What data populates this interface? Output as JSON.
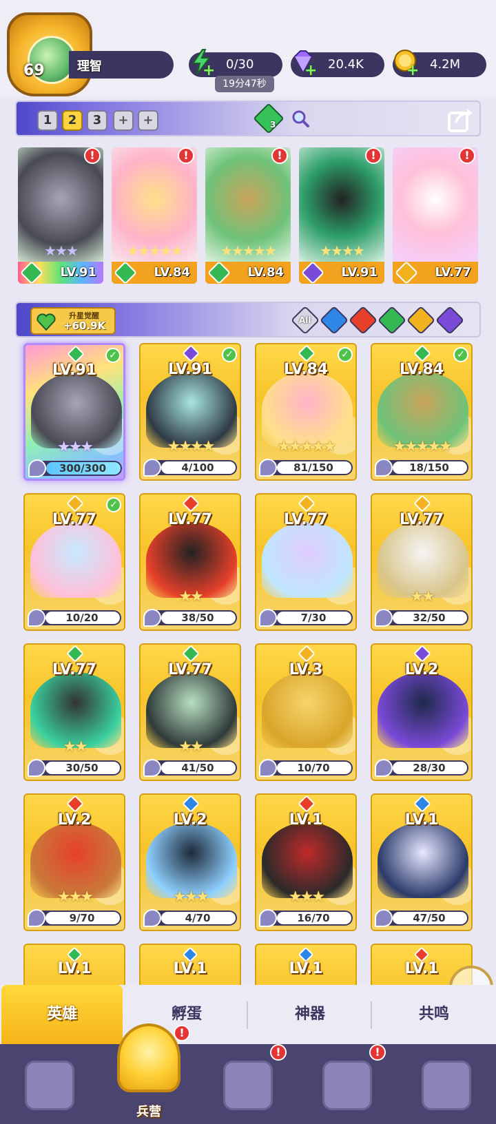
{
  "player": {
    "level": "69",
    "name": "理智"
  },
  "resources": {
    "energy": {
      "value": "0/30",
      "timer": "19分47秒",
      "icon": "lightning-icon",
      "color": "#49d36a"
    },
    "gems": {
      "value": "20.4K",
      "icon": "diamond-icon",
      "color": "#9b6bff"
    },
    "gold": {
      "value": "4.2M",
      "icon": "coin-icon",
      "color": "#f5c227"
    }
  },
  "team_tabs": {
    "slots": [
      "1",
      "2",
      "3",
      "+",
      "+"
    ],
    "active_slot": "2",
    "team_gem_count": "3"
  },
  "team": [
    {
      "level": "LV.91",
      "element": "nature",
      "stars": "★★★",
      "star_style": "purple",
      "bar": "rainbow",
      "alert": "!"
    },
    {
      "level": "LV.84",
      "element": "nature",
      "stars": "★★★★★",
      "star_style": "gold",
      "bar": "gold",
      "alert": "!"
    },
    {
      "level": "LV.84",
      "element": "nature",
      "stars": "★★★★★",
      "star_style": "gold",
      "bar": "gold",
      "alert": "!"
    },
    {
      "level": "LV.91",
      "element": "dark",
      "stars": "★★★★",
      "star_style": "gold",
      "bar": "gold",
      "alert": "!"
    },
    {
      "level": "LV.77",
      "element": "light",
      "stars": "",
      "star_style": "gold",
      "bar": "gold",
      "alert": "!"
    }
  ],
  "filter": {
    "awaken_title": "升星觉醒",
    "awaken_value": "+60.9K",
    "all_label": "All",
    "elements": [
      "water",
      "fire",
      "nature",
      "light",
      "dark"
    ]
  },
  "element_colors": {
    "nature": "#34b852",
    "dark": "#7a4ad8",
    "light": "#f2b21f",
    "fire": "#e6402a",
    "water": "#2e86e6"
  },
  "heroes": [
    {
      "level": "LV.91",
      "element": "nature",
      "stars": "★★★",
      "star_style": "purple",
      "progress": "300/300",
      "fill": 1.0,
      "checked": true,
      "rainbow": true,
      "portrait": [
        "#4a4a55",
        "#a5a5b5"
      ]
    },
    {
      "level": "LV.91",
      "element": "dark",
      "stars": "★★★★",
      "star_style": "gold",
      "progress": "4/100",
      "fill": 0.04,
      "checked": true,
      "rainbow": false,
      "portrait": [
        "#2e3a45",
        "#a8e6e0"
      ]
    },
    {
      "level": "LV.84",
      "element": "nature",
      "stars": "★★★★★",
      "star_style": "gold",
      "progress": "81/150",
      "fill": 0.54,
      "checked": true,
      "rainbow": false,
      "portrait": [
        "#ffe08a",
        "#ffb3c8"
      ]
    },
    {
      "level": "LV.84",
      "element": "nature",
      "stars": "★★★★★",
      "star_style": "gold",
      "progress": "18/150",
      "fill": 0.12,
      "checked": true,
      "rainbow": false,
      "portrait": [
        "#6fc27a",
        "#c9a45a"
      ]
    },
    {
      "level": "LV.77",
      "element": "light",
      "stars": "",
      "star_style": "gold",
      "progress": "10/20",
      "fill": 0.5,
      "checked": true,
      "rainbow": false,
      "portrait": [
        "#ffc0d8",
        "#c8e9ff"
      ]
    },
    {
      "level": "LV.77",
      "element": "fire",
      "stars": "★★",
      "star_style": "gold",
      "progress": "38/50",
      "fill": 0.76,
      "checked": false,
      "rainbow": false,
      "portrait": [
        "#e6402a",
        "#222"
      ]
    },
    {
      "level": "LV.77",
      "element": "light",
      "stars": "",
      "star_style": "gold",
      "progress": "7/30",
      "fill": 0.23,
      "checked": false,
      "rainbow": false,
      "portrait": [
        "#bfe6ff",
        "#e0ccff"
      ]
    },
    {
      "level": "LV.77",
      "element": "light",
      "stars": "★★",
      "star_style": "gold",
      "progress": "32/50",
      "fill": 0.64,
      "checked": false,
      "rainbow": false,
      "portrait": [
        "#d9c58a",
        "#f4f4f4"
      ]
    },
    {
      "level": "LV.77",
      "element": "nature",
      "stars": "★★",
      "star_style": "gold",
      "progress": "30/50",
      "fill": 0.6,
      "checked": false,
      "rainbow": false,
      "portrait": [
        "#3ad0a0",
        "#333"
      ]
    },
    {
      "level": "LV.77",
      "element": "nature",
      "stars": "★★",
      "star_style": "gold",
      "progress": "41/50",
      "fill": 0.82,
      "checked": false,
      "rainbow": false,
      "portrait": [
        "#2f3a3a",
        "#b8e0c0"
      ]
    },
    {
      "level": "LV.3",
      "element": "light",
      "stars": "",
      "star_style": "gold",
      "progress": "10/70",
      "fill": 0.14,
      "checked": false,
      "rainbow": false,
      "portrait": [
        "#d9a52a",
        "#f6d56b"
      ]
    },
    {
      "level": "LV.2",
      "element": "dark",
      "stars": "",
      "star_style": "gold",
      "progress": "28/30",
      "fill": 0.93,
      "checked": false,
      "rainbow": false,
      "portrait": [
        "#7a4ad8",
        "#1e2a4a"
      ]
    },
    {
      "level": "LV.2",
      "element": "fire",
      "stars": "★★★",
      "star_style": "gold",
      "progress": "9/70",
      "fill": 0.13,
      "checked": false,
      "rainbow": false,
      "portrait": [
        "#c97a3a",
        "#e6402a"
      ]
    },
    {
      "level": "LV.2",
      "element": "water",
      "stars": "★★★",
      "star_style": "gold",
      "progress": "4/70",
      "fill": 0.06,
      "checked": false,
      "rainbow": false,
      "portrait": [
        "#8fd0ff",
        "#1e2a3a"
      ]
    },
    {
      "level": "LV.1",
      "element": "fire",
      "stars": "★★★",
      "star_style": "gold",
      "progress": "16/70",
      "fill": 0.23,
      "checked": false,
      "rainbow": false,
      "portrait": [
        "#2a2a2a",
        "#c02a2a"
      ]
    },
    {
      "level": "LV.1",
      "element": "water",
      "stars": "",
      "star_style": "gold",
      "progress": "47/50",
      "fill": 0.94,
      "checked": false,
      "rainbow": false,
      "portrait": [
        "#2a3a6a",
        "#e8e8ff"
      ]
    }
  ],
  "peek_row": [
    {
      "level": "LV.1",
      "element": "nature"
    },
    {
      "level": "LV.1",
      "element": "water"
    },
    {
      "level": "LV.1",
      "element": "water"
    },
    {
      "level": "LV.1",
      "element": "fire"
    }
  ],
  "float_button": {
    "alert": "!"
  },
  "subtabs": [
    "英雄",
    "孵蛋",
    "神器",
    "共鸣"
  ],
  "active_subtab": "英雄",
  "bottom_nav": [
    {
      "label": "",
      "icon": "cards-icon",
      "alert": ""
    },
    {
      "label": "兵营",
      "icon": "barracks-icon",
      "alert": "!"
    },
    {
      "label": "",
      "icon": "book-icon",
      "alert": "!"
    },
    {
      "label": "",
      "icon": "castle-icon",
      "alert": "!"
    },
    {
      "label": "",
      "icon": "mushroom-icon",
      "alert": ""
    }
  ]
}
